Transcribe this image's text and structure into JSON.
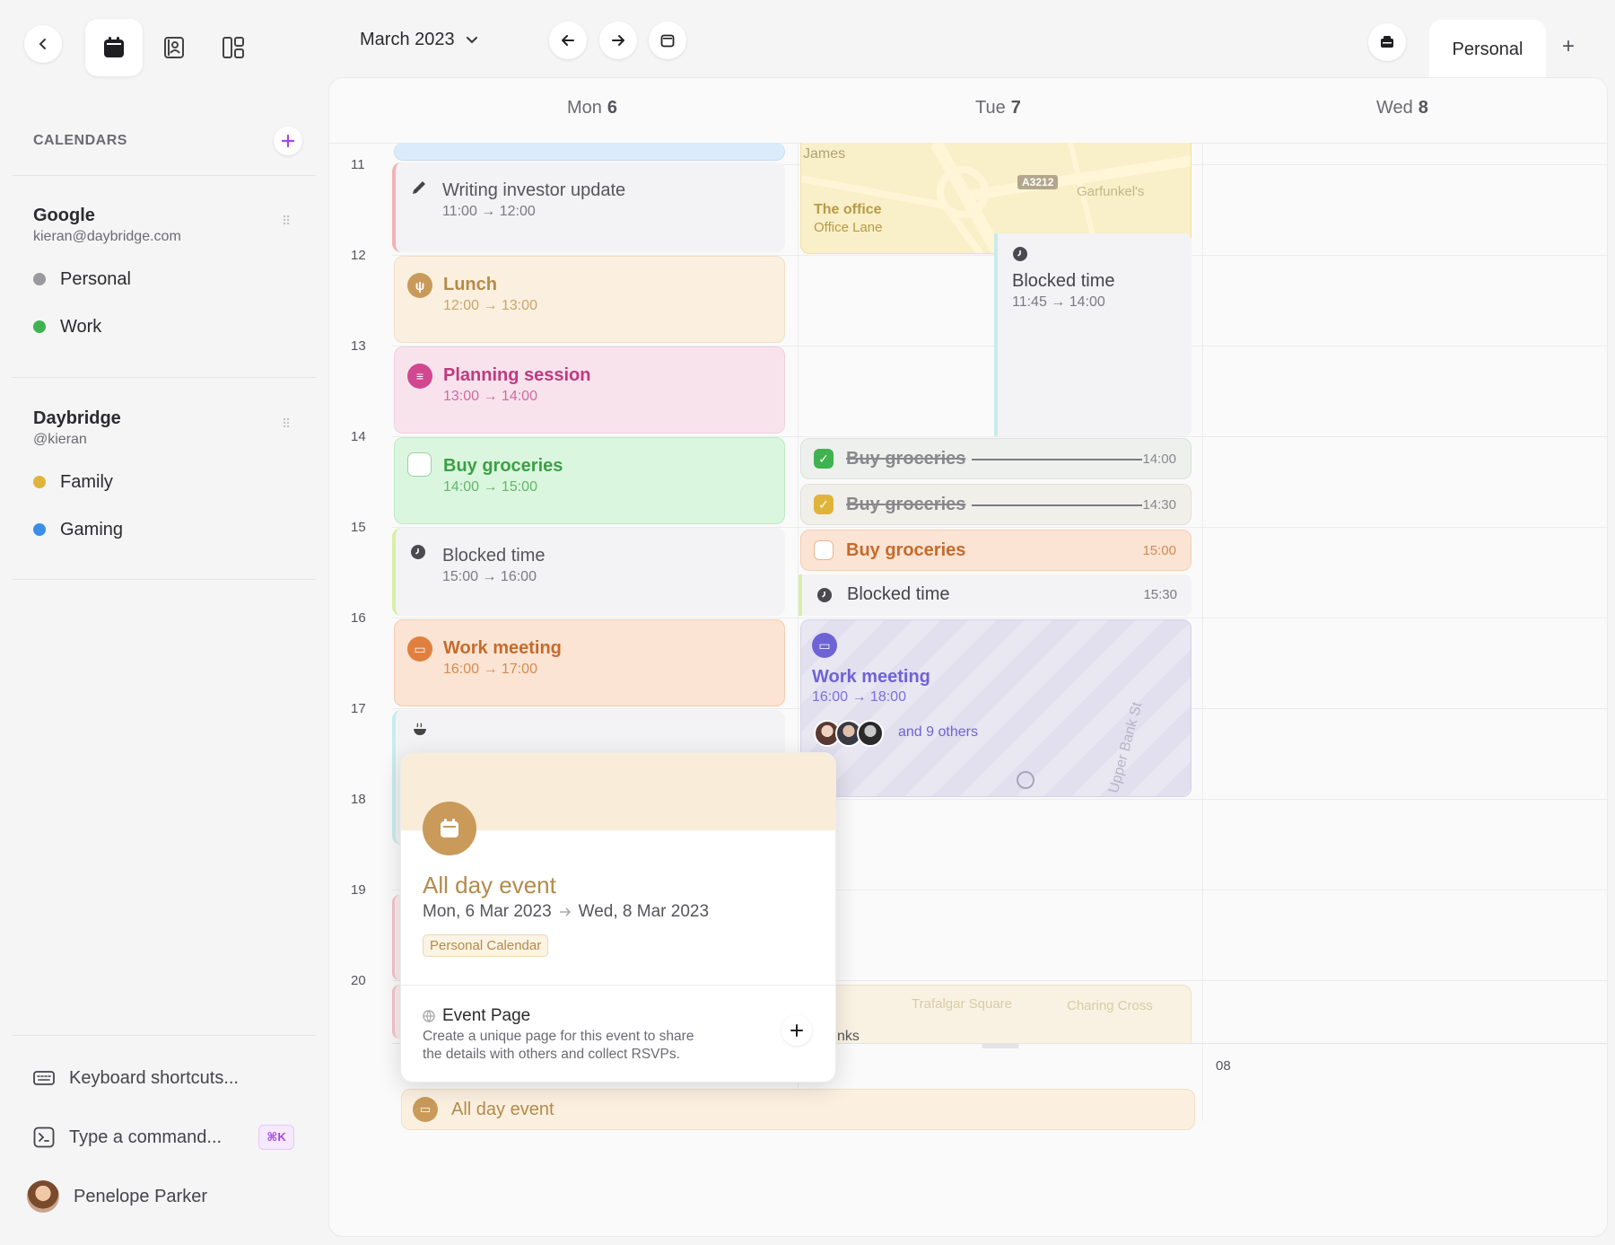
{
  "toolbar": {
    "month_label": "March 2023",
    "account_tab": "Personal",
    "add_tab": "+"
  },
  "sidebar": {
    "section_title": "CALENDARS",
    "accounts": [
      {
        "name": "Google",
        "sub": "kieran@daybridge.com",
        "calendars": [
          {
            "label": "Personal",
            "color": "#9a9a9e"
          },
          {
            "label": "Work",
            "color": "#3fb34f"
          }
        ]
      },
      {
        "name": "Daybridge",
        "sub": "@kieran",
        "calendars": [
          {
            "label": "Family",
            "color": "#e0b43a"
          },
          {
            "label": "Gaming",
            "color": "#3b8ee8"
          }
        ]
      }
    ],
    "footer": {
      "shortcuts": "Keyboard shortcuts...",
      "command": "Type a command...",
      "command_kbd": "⌘K",
      "user": "Penelope Parker"
    }
  },
  "days": [
    {
      "name": "Mon",
      "num": "6"
    },
    {
      "name": "Tue",
      "num": "7"
    },
    {
      "name": "Wed",
      "num": "8"
    }
  ],
  "hours": [
    "11",
    "12",
    "13",
    "14",
    "15",
    "16",
    "17",
    "18",
    "19",
    "20"
  ],
  "monday_events": [
    {
      "title": "Writing investor update",
      "time": "11:00 → 12:00"
    },
    {
      "title": "Lunch",
      "time": "12:00 → 13:00"
    },
    {
      "title": "Planning session",
      "time": "13:00 → 14:00"
    },
    {
      "title": "Buy groceries",
      "time": "14:00 → 15:00"
    },
    {
      "title": "Blocked time",
      "time": "15:00 → 16:00"
    },
    {
      "title": "Work meeting",
      "time": "16:00 → 17:00"
    }
  ],
  "tuesday_events": {
    "office_title": "The office",
    "office_sub": "Office Lane",
    "map_labels": {
      "james": "James",
      "road": "A3212",
      "garfunkels": "Garfunkel's",
      "upper_bank": "Upper Bank St",
      "trafalgar": "Trafalgar Square",
      "charing": "Charing Cross",
      "links": "nks"
    },
    "blocked1": {
      "title": "Blocked time",
      "time": "11:45 → 14:00"
    },
    "strips": [
      {
        "title": "Buy groceries",
        "time": "14:00"
      },
      {
        "title": "Buy groceries",
        "time": "14:30"
      },
      {
        "title": "Buy groceries",
        "time": "15:00"
      },
      {
        "title": "Blocked time",
        "time": "15:30"
      }
    ],
    "meeting": {
      "title": "Work meeting",
      "time": "16:00 → 18:00",
      "others": "and 9 others"
    }
  },
  "popup": {
    "title": "All day event",
    "date_from": "Mon, 6 Mar 2023",
    "date_to": "Wed, 8 Mar 2023",
    "calendar_tag": "Personal Calendar",
    "page_title": "Event Page",
    "page_desc_1": "Create a unique page for this event to share",
    "page_desc_2": "the details with others and collect RSVPs."
  },
  "allday": {
    "label": "All day event",
    "wed_label": "08"
  },
  "colors": {
    "accent": "#a346e0",
    "lunch": "#b58a4a",
    "planning": "#c2387f",
    "groceries": "#3ba046",
    "meeting": "#c56b2c",
    "tue_meeting": "#6e63d4"
  }
}
